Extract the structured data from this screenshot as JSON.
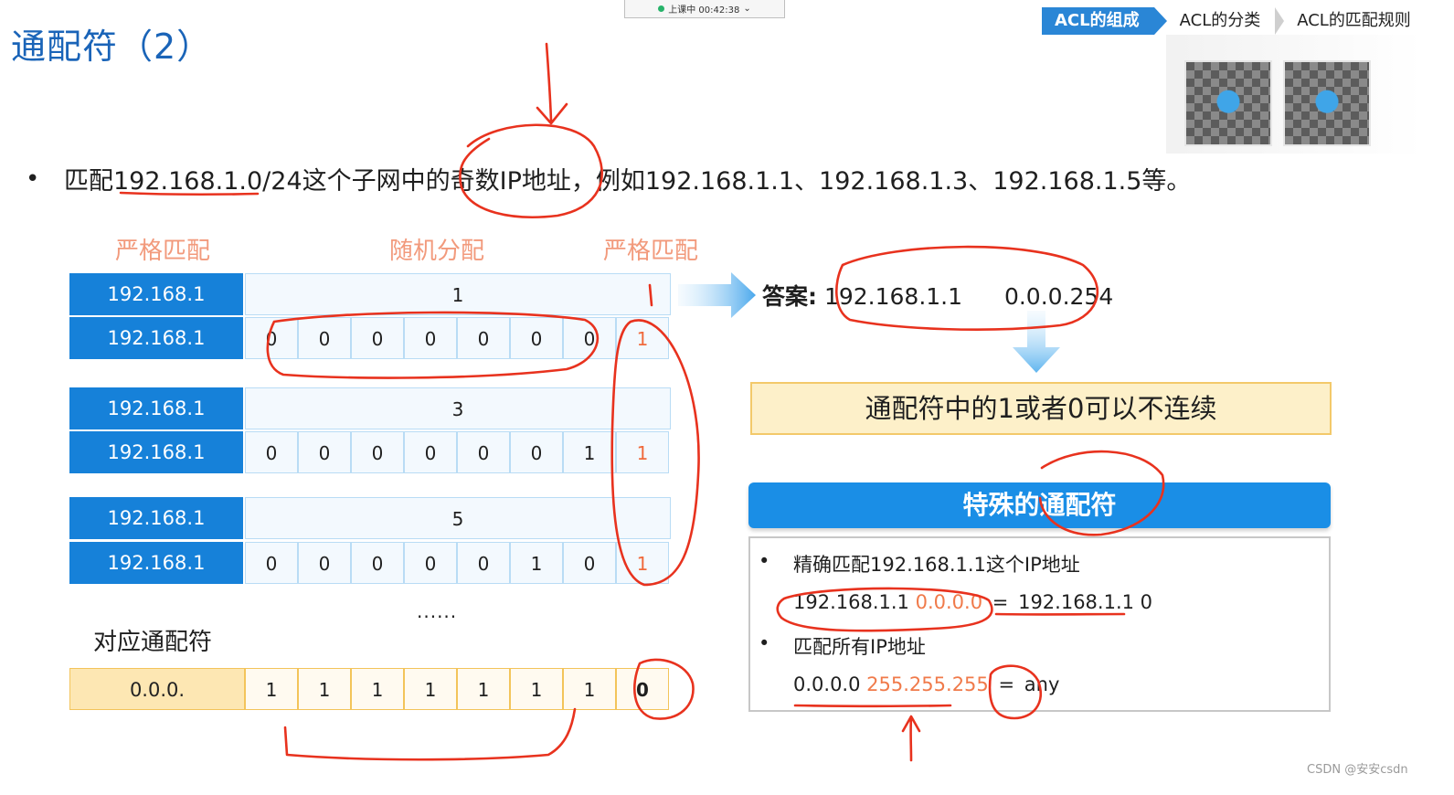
{
  "slide": {
    "title": "通配符（2）",
    "status_text": "上课中 00:42:38",
    "status_caret": "⌄",
    "breadcrumbs": [
      "ACL的组成",
      "ACL的分类",
      "ACL的匹配规则"
    ],
    "bullet": "•",
    "sentence": "匹配192.168.1.0/24这个子网中的奇数IP地址，例如192.168.1.1、192.168.1.3、192.168.1.5等。"
  },
  "table": {
    "headers": [
      "严格匹配",
      "随机分配",
      "严格匹配"
    ],
    "groups": [
      {
        "prefix": "192.168.1",
        "decimal": "1",
        "bits": [
          "0",
          "0",
          "0",
          "0",
          "0",
          "0",
          "0",
          "1"
        ]
      },
      {
        "prefix": "192.168.1",
        "decimal": "3",
        "bits": [
          "0",
          "0",
          "0",
          "0",
          "0",
          "0",
          "1",
          "1"
        ]
      },
      {
        "prefix": "192.168.1",
        "decimal": "5",
        "bits": [
          "0",
          "0",
          "0",
          "0",
          "0",
          "1",
          "0",
          "1"
        ]
      }
    ],
    "ellipsis": "......",
    "wildcard_label": "对应通配符",
    "wildcard": {
      "prefix": "0.0.0.",
      "bits": [
        "1",
        "1",
        "1",
        "1",
        "1",
        "1",
        "1",
        "0"
      ]
    }
  },
  "right": {
    "answer_label": "答案:",
    "answer_ip": "192.168.1.1",
    "answer_mask": "0.0.0.254",
    "note": "通配符中的1或者0可以不连续",
    "special_title": "特殊的通配符",
    "items": [
      {
        "bullet": "•",
        "text": "精确匹配192.168.1.1这个IP地址",
        "ip": "192.168.1.1",
        "mask": "0.0.0.0",
        "eq": "=",
        "result": "192.168.1.1 0"
      },
      {
        "bullet": "•",
        "text": "匹配所有IP地址",
        "ip": "0.0.0.0",
        "mask": "255.255.255",
        "eq": "=",
        "result": "any"
      }
    ]
  },
  "watermark": "CSDN @安安csdn",
  "colors": {
    "accent_blue": "#1681d9",
    "orange": "#f06a3c",
    "annotation_red": "#e8321e",
    "yellow": "#fde7b3"
  }
}
